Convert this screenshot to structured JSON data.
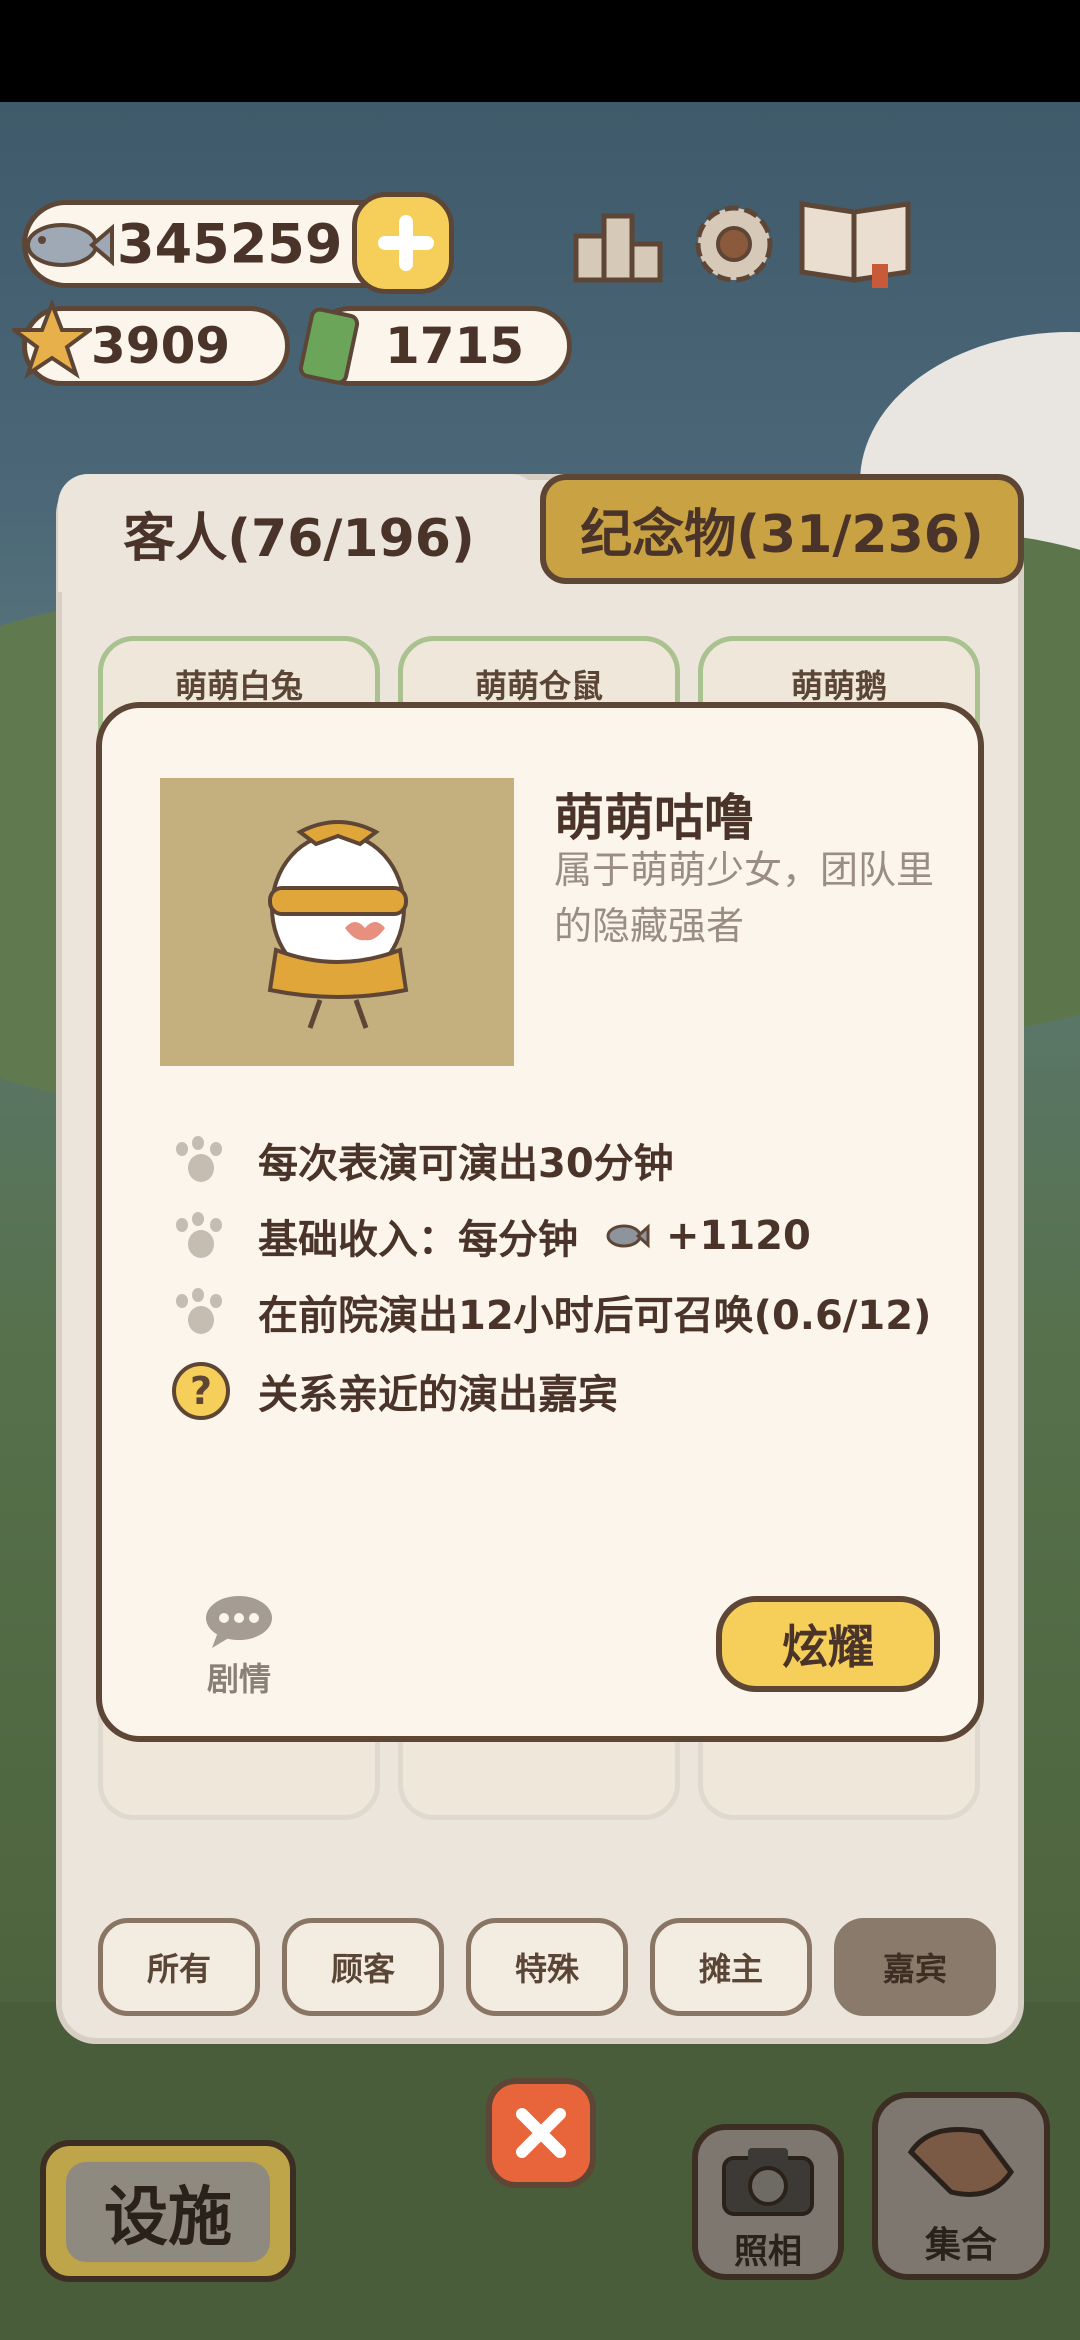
{
  "resources": {
    "fish": "345259",
    "stars": "3909",
    "tickets": "1715"
  },
  "top_icons": [
    "ranking-podium-icon",
    "gear-icon",
    "book-icon"
  ],
  "tabs": {
    "guests": "客人(76/196)",
    "souvenirs": "纪念物(31/236)"
  },
  "cards_top": [
    "萌萌白兔",
    "萌萌仓鼠",
    "萌萌鹅"
  ],
  "detail": {
    "name": "萌萌咕噜",
    "description": "属于萌萌少女，团队里的隐藏强者",
    "rows": [
      "每次表演可演出30分钟",
      "基础收入：每分钟",
      "在前院演出12小时后可召唤(0.6/12)",
      "关系亲近的演出嘉宾"
    ],
    "income_value": "+1120",
    "story_label": "剧情",
    "show_button": "炫耀"
  },
  "filters": [
    "所有",
    "顾客",
    "特殊",
    "摊主",
    "嘉宾"
  ],
  "selected_filter": "嘉宾",
  "bottom": {
    "facilities": "设施",
    "camera": "照相",
    "gather": "集合"
  },
  "colors": {
    "accent_yellow": "#f5cf5a",
    "panel": "#fbf5ec",
    "outline": "#5e4636",
    "close_orange": "#e8643a"
  }
}
